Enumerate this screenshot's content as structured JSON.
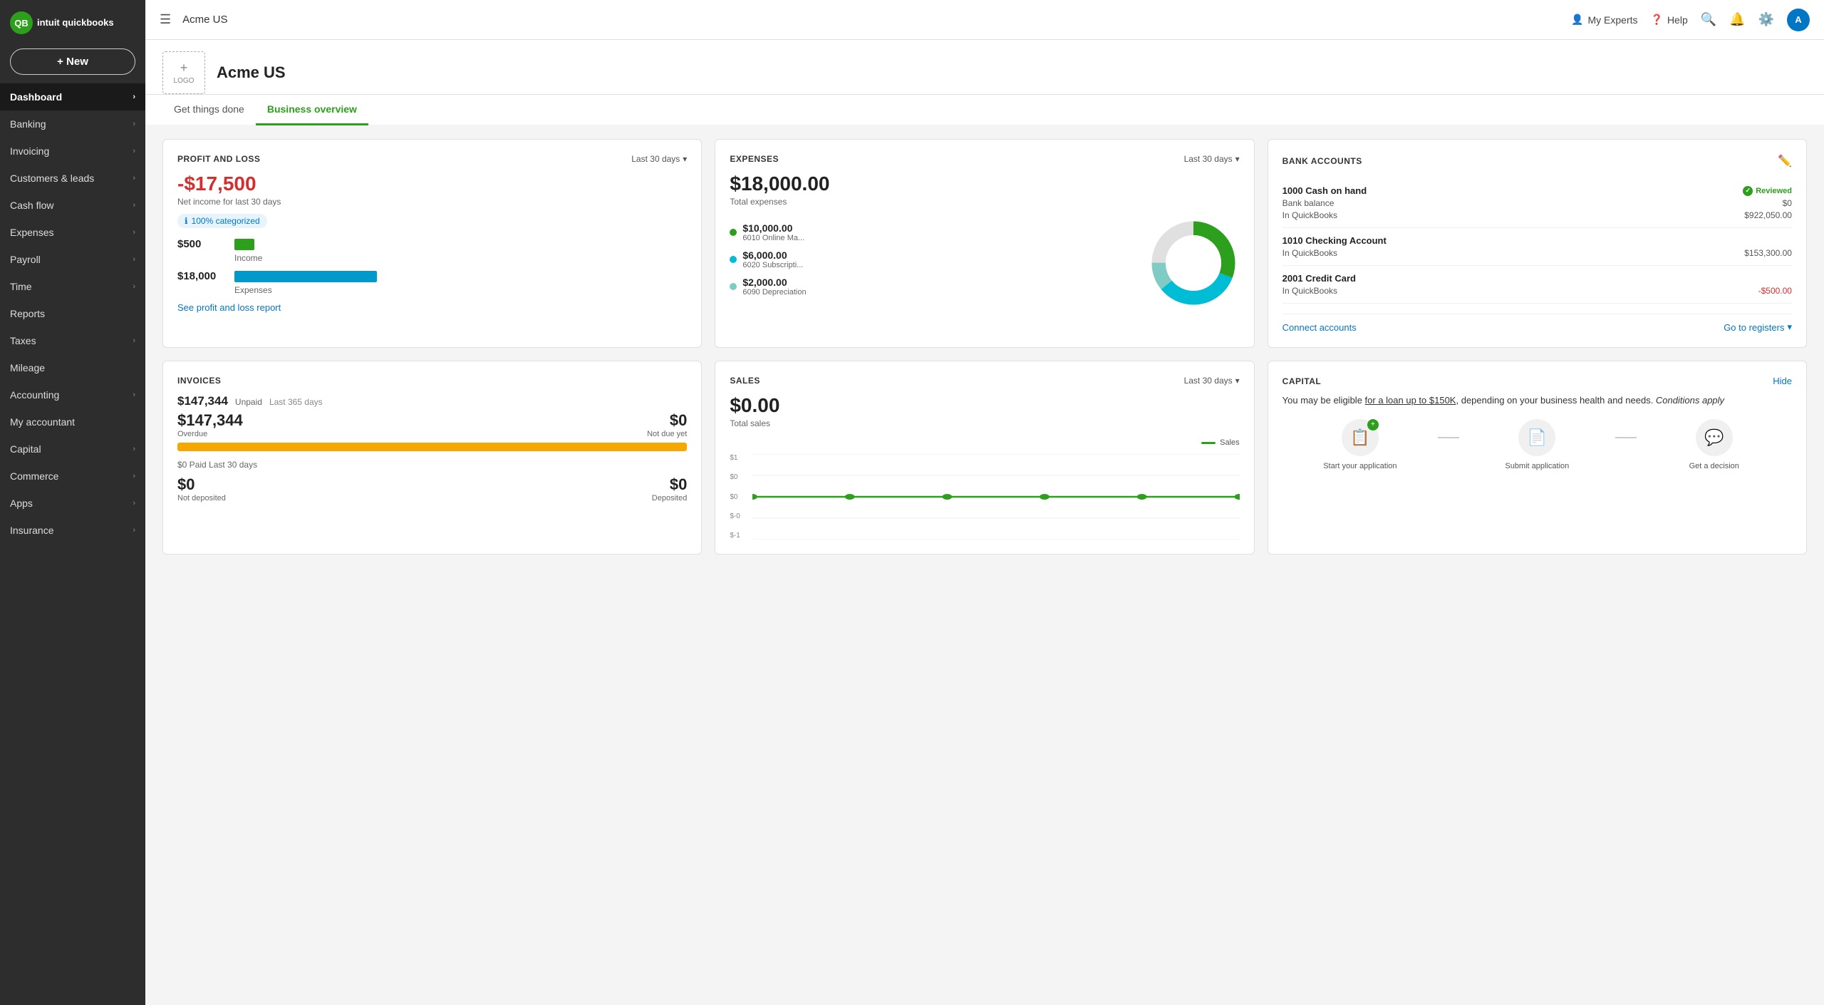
{
  "sidebar": {
    "logo_initials": "QB",
    "logo_brand": "intuit quickbooks",
    "new_button": "+ New",
    "items": [
      {
        "label": "Dashboard",
        "active": true,
        "has_chevron": true
      },
      {
        "label": "Banking",
        "active": false,
        "has_chevron": true
      },
      {
        "label": "Invoicing",
        "active": false,
        "has_chevron": true
      },
      {
        "label": "Customers & leads",
        "active": false,
        "has_chevron": true
      },
      {
        "label": "Cash flow",
        "active": false,
        "has_chevron": true
      },
      {
        "label": "Expenses",
        "active": false,
        "has_chevron": true
      },
      {
        "label": "Payroll",
        "active": false,
        "has_chevron": true
      },
      {
        "label": "Time",
        "active": false,
        "has_chevron": true
      },
      {
        "label": "Reports",
        "active": false,
        "has_chevron": false
      },
      {
        "label": "Taxes",
        "active": false,
        "has_chevron": true
      },
      {
        "label": "Mileage",
        "active": false,
        "has_chevron": false
      },
      {
        "label": "Accounting",
        "active": false,
        "has_chevron": true
      },
      {
        "label": "My accountant",
        "active": false,
        "has_chevron": false
      },
      {
        "label": "Capital",
        "active": false,
        "has_chevron": true
      },
      {
        "label": "Commerce",
        "active": false,
        "has_chevron": true
      },
      {
        "label": "Apps",
        "active": false,
        "has_chevron": true
      },
      {
        "label": "Insurance",
        "active": false,
        "has_chevron": true
      }
    ]
  },
  "header": {
    "company": "Acme US",
    "my_experts": "My Experts",
    "help": "Help",
    "avatar_initials": "A"
  },
  "company_banner": {
    "logo_plus": "+",
    "logo_text": "LOGO",
    "company_name": "Acme US"
  },
  "tabs": [
    {
      "label": "Get things done",
      "active": false
    },
    {
      "label": "Business overview",
      "active": true
    }
  ],
  "pnl_card": {
    "title": "PROFIT AND LOSS",
    "period": "Last 30 days",
    "net_income": "-$17,500",
    "net_income_label": "Net income for last 30 days",
    "badge": "100% categorized",
    "income_amount": "$500",
    "income_label": "Income",
    "expense_amount": "$18,000",
    "expense_label": "Expenses",
    "see_report": "See profit and loss report"
  },
  "expenses_card": {
    "title": "EXPENSES",
    "period": "Last 30 days",
    "total_amount": "$18,000.00",
    "total_label": "Total expenses",
    "items": [
      {
        "color": "#2ca01c",
        "amount": "$10,000.00",
        "label": "6010 Online Ma..."
      },
      {
        "color": "#00bcd4",
        "amount": "$6,000.00",
        "label": "6020 Subscripti..."
      },
      {
        "color": "#80cbc4",
        "amount": "$2,000.00",
        "label": "6090 Depreciation"
      }
    ]
  },
  "bank_accounts_card": {
    "title": "BANK ACCOUNTS",
    "accounts": [
      {
        "name": "1000 Cash on hand",
        "reviewed": true,
        "reviewed_label": "Reviewed",
        "bank_balance_label": "Bank balance",
        "bank_balance": "$0",
        "qb_label": "In QuickBooks",
        "qb_balance": "$922,050.00"
      },
      {
        "name": "1010 Checking Account",
        "reviewed": false,
        "qb_label": "In QuickBooks",
        "qb_balance": "$153,300.00"
      },
      {
        "name": "2001 Credit Card",
        "reviewed": false,
        "qb_label": "In QuickBooks",
        "qb_balance": "-$500.00"
      }
    ],
    "connect_accounts": "Connect accounts",
    "go_registers": "Go to registers"
  },
  "invoices_card": {
    "title": "INVOICES",
    "unpaid_amount": "$147,344",
    "unpaid_label": "Unpaid",
    "unpaid_period": "Last 365 days",
    "overdue_amount": "$147,344",
    "overdue_label": "Overdue",
    "notdue_amount": "$0",
    "notdue_label": "Not due yet",
    "paid_period": "$0 Paid   Last 30 days",
    "not_deposited": "$0",
    "not_deposited_label": "Not deposited",
    "deposited": "$0",
    "deposited_label": "Deposited"
  },
  "sales_card": {
    "title": "SALES",
    "period": "Last 30 days",
    "total_amount": "$0.00",
    "total_label": "Total sales",
    "legend": "Sales",
    "y_labels": [
      "$1",
      "$0",
      "$0",
      "$-0",
      "$-1"
    ]
  },
  "capital_card": {
    "title": "CAPITAL",
    "hide_label": "Hide",
    "description_part1": "You may be eligible ",
    "description_link": "for a loan up to $150K",
    "description_part2": ", depending on your business health and needs. ",
    "description_italic": "Conditions apply",
    "steps": [
      {
        "icon": "📋",
        "label": "Start your application",
        "has_badge": true
      },
      {
        "icon": "📄",
        "label": "Submit application",
        "has_badge": false
      },
      {
        "icon": "💬",
        "label": "Get a decision",
        "has_badge": false
      }
    ]
  }
}
